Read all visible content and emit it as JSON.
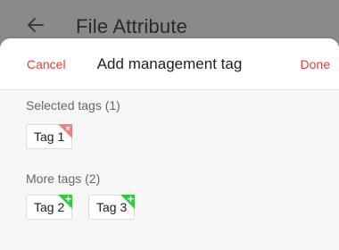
{
  "background": {
    "title": "File Attribute",
    "back_icon": "arrow-left-icon"
  },
  "sheet": {
    "cancel_label": "Cancel",
    "title": "Add management tag",
    "done_label": "Done"
  },
  "selected": {
    "label": "Selected tags (1)",
    "tags": [
      {
        "label": "Tag 1",
        "badge": "remove-icon",
        "badge_color": "#f08080"
      }
    ]
  },
  "more": {
    "label": "More tags (2)",
    "tags": [
      {
        "label": "Tag 2",
        "badge": "add-icon",
        "badge_color": "#2ecc40"
      },
      {
        "label": "Tag 3",
        "badge": "add-icon",
        "badge_color": "#2ecc40"
      }
    ]
  },
  "colors": {
    "accent": "#d6433a",
    "dim_overlay": "#8a8a8a",
    "sheet_bg": "#f7f7f7"
  }
}
